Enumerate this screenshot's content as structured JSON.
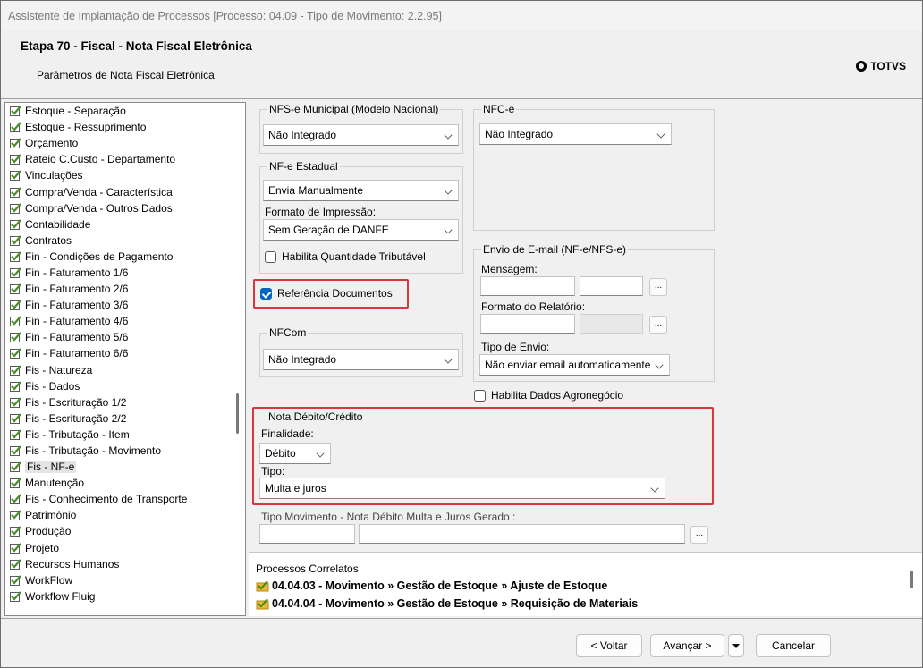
{
  "window": {
    "title": "Assistente de Implantação de Processos [Processo: 04.09 - Tipo de Movimento: 2.2.95]",
    "step_title": "Etapa 70 - Fiscal - Nota Fiscal Eletrônica",
    "step_subtitle": "Parâmetros de Nota Fiscal Eletrônica",
    "logo": "TOTVS"
  },
  "tree": {
    "items": [
      "Estoque - Separação",
      "Estoque - Ressuprimento",
      "Orçamento",
      "Rateio C.Custo - Departamento",
      "Vinculações",
      "Compra/Venda - Característica",
      "Compra/Venda - Outros Dados",
      "Contabilidade",
      "Contratos",
      "Fin - Condições de Pagamento",
      "Fin - Faturamento 1/6",
      "Fin - Faturamento 2/6",
      "Fin - Faturamento 3/6",
      "Fin - Faturamento 4/6",
      "Fin - Faturamento 5/6",
      "Fin - Faturamento 6/6",
      "Fis - Natureza",
      "Fis - Dados",
      "Fis - Escrituração 1/2",
      "Fis - Escrituração 2/2",
      "Fis - Tributação - Item",
      "Fis - Tributação - Movimento",
      "Fis - NF-e",
      "Manutenção",
      "Fis - Conhecimento de Transporte",
      "Patrimônio",
      "Produção",
      "Projeto",
      "Recursos Humanos",
      "WorkFlow",
      "Workflow Fluig"
    ],
    "selected_index": 22
  },
  "nfse": {
    "legend": "NFS-e Municipal (Modelo Nacional)",
    "value": "Não Integrado"
  },
  "nfce": {
    "legend": "NFC-e",
    "value": "Não Integrado"
  },
  "nfe": {
    "legend": "NF-e Estadual",
    "value": "Envia Manualmente",
    "print_format_label": "Formato de Impressão:",
    "print_format_value": "Sem Geração de DANFE",
    "qty_check_label": "Habilita Quantidade Tributável"
  },
  "ref_docs": {
    "label": "Referência Documentos",
    "checked": true
  },
  "email": {
    "legend": "Envio de E-mail (NF-e/NFS-e)",
    "message_label": "Mensagem:",
    "report_format_label": "Formato do Relatório:",
    "send_type_label": "Tipo de Envio:",
    "send_type_value": "Não enviar email automaticamente",
    "dots": "..."
  },
  "agro": {
    "label": "Habilita Dados Agronegócio",
    "checked": false
  },
  "nfcom": {
    "legend": "NFCom",
    "value": "Não Integrado"
  },
  "debit_note": {
    "legend": "Nota Débito/Crédito",
    "purpose_label": "Finalidade:",
    "purpose_value": "Débito",
    "type_label": "Tipo:",
    "type_value": "Multa e juros"
  },
  "movement_type": {
    "label": "Tipo Movimento - Nota Débito Multa e Juros Gerado :",
    "dots": "..."
  },
  "correlated": {
    "title": "Processos Correlatos",
    "items": [
      "04.04.03 - Movimento » Gestão de Estoque » Ajuste de Estoque",
      "04.04.04 - Movimento » Gestão de Estoque » Requisição de Materiais"
    ]
  },
  "footer": {
    "back": "< Voltar",
    "next": "Avançar >",
    "cancel": "Cancelar"
  },
  "colors": {
    "highlight": "#d9363e",
    "checkbox": "#0067c0",
    "tree_check": "#4a8c2a"
  }
}
